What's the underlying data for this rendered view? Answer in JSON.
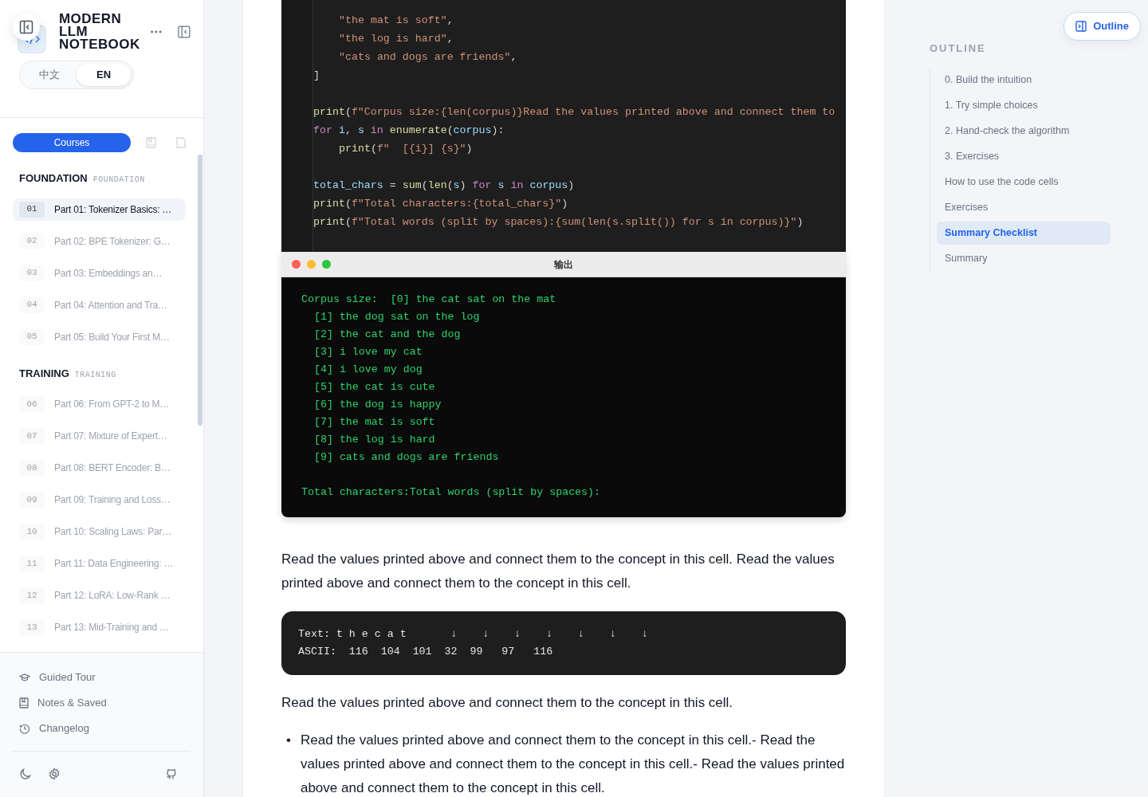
{
  "sidebar": {
    "title": [
      "MODERN",
      "LLM",
      "NOTEBOOK"
    ],
    "languages": [
      {
        "label": "中文",
        "selected": false
      },
      {
        "label": "EN",
        "selected": true
      }
    ],
    "tabs": [
      {
        "kind": "label",
        "label": "Courses",
        "selected": true
      },
      {
        "kind": "notebook",
        "selected": false
      },
      {
        "kind": "page",
        "selected": false
      }
    ],
    "sections": [
      {
        "title": "FOUNDATION",
        "subtitle": "FOUNDATION",
        "items": [
          {
            "number": "01",
            "title": "Part 01: Tokenizer Basics: …",
            "selected": true
          },
          {
            "number": "02",
            "title": "Part 02: BPE Tokenizer: G…",
            "selected": false
          },
          {
            "number": "03",
            "title": "Part 03: Embeddings an…",
            "selected": false
          },
          {
            "number": "04",
            "title": "Part 04: Attention and Tra…",
            "selected": false
          },
          {
            "number": "05",
            "title": "Part 05: Build Your First M…",
            "selected": false
          }
        ]
      },
      {
        "title": "TRAINING",
        "subtitle": "TRAINING",
        "items": [
          {
            "number": "06",
            "title": "Part 06: From GPT-2 to M…",
            "selected": false
          },
          {
            "number": "07",
            "title": "Part 07: Mixture of Expert…",
            "selected": false
          },
          {
            "number": "08",
            "title": "Part 08: BERT Encoder: B…",
            "selected": false
          },
          {
            "number": "09",
            "title": "Part 09: Training and Loss…",
            "selected": false
          },
          {
            "number": "10",
            "title": "Part 10: Scaling Laws: Par…",
            "selected": false
          },
          {
            "number": "11",
            "title": "Part 11: Data Engineering: …",
            "selected": false
          },
          {
            "number": "12",
            "title": "Part 12: LoRA: Low-Rank …",
            "selected": false
          },
          {
            "number": "13",
            "title": "Part 13: Mid-Training and …",
            "selected": false
          }
        ]
      }
    ],
    "footer_links": [
      {
        "kind": "tour",
        "label": "Guided Tour"
      },
      {
        "kind": "notes",
        "label": "Notes & Saved"
      },
      {
        "kind": "history",
        "label": "Changelog"
      }
    ]
  },
  "code_cell": {
    "blocks": [
      [
        {
          "indent": true,
          "tokens": [
            {
              "kind": "str",
              "text": "\"the mat is soft\""
            },
            {
              "kind": "plain",
              "text": ","
            }
          ]
        },
        {
          "indent": true,
          "tokens": [
            {
              "kind": "str",
              "text": "\"the log is hard\""
            },
            {
              "kind": "plain",
              "text": ","
            }
          ]
        },
        {
          "indent": true,
          "tokens": [
            {
              "kind": "str",
              "text": "\"cats and dogs are friends\""
            },
            {
              "kind": "plain",
              "text": ","
            }
          ]
        },
        {
          "indent": false,
          "tokens": [
            {
              "kind": "plain",
              "text": "]"
            }
          ]
        }
      ],
      [
        {
          "indent": false,
          "tokens": [
            {
              "kind": "fn",
              "text": "print"
            },
            {
              "kind": "plain",
              "text": "("
            },
            {
              "kind": "str",
              "text": "f\"Corpus size:{len(corpus)}Read the values printed above and connect them to"
            }
          ]
        },
        {
          "indent": false,
          "tokens": [
            {
              "kind": "kw",
              "text": "for"
            },
            {
              "kind": "var",
              "text": " i"
            },
            {
              "kind": "plain",
              "text": ", "
            },
            {
              "kind": "var",
              "text": "s"
            },
            {
              "kind": "kw",
              "text": " in"
            },
            {
              "kind": "fn",
              "text": " enumerate"
            },
            {
              "kind": "plain",
              "text": "("
            },
            {
              "kind": "var",
              "text": "corpus"
            },
            {
              "kind": "plain",
              "text": "):"
            }
          ]
        },
        {
          "indent": true,
          "tokens": [
            {
              "kind": "fn",
              "text": "print"
            },
            {
              "kind": "plain",
              "text": "("
            },
            {
              "kind": "str",
              "text": "f\"  [{i}] {s}\""
            },
            {
              "kind": "plain",
              "text": ")"
            }
          ]
        }
      ],
      [
        {
          "indent": false,
          "tokens": [
            {
              "kind": "var",
              "text": "total_chars"
            },
            {
              "kind": "plain",
              "text": " = "
            },
            {
              "kind": "fn",
              "text": "sum"
            },
            {
              "kind": "plain",
              "text": "("
            },
            {
              "kind": "fn",
              "text": "len"
            },
            {
              "kind": "plain",
              "text": "("
            },
            {
              "kind": "var",
              "text": "s"
            },
            {
              "kind": "plain",
              "text": ") "
            },
            {
              "kind": "kw",
              "text": "for"
            },
            {
              "kind": "var",
              "text": " s"
            },
            {
              "kind": "kw",
              "text": " in"
            },
            {
              "kind": "var",
              "text": " corpus"
            },
            {
              "kind": "plain",
              "text": ")"
            }
          ]
        },
        {
          "indent": false,
          "tokens": [
            {
              "kind": "fn",
              "text": "print"
            },
            {
              "kind": "plain",
              "text": "("
            },
            {
              "kind": "str",
              "text": "f\"Total characters:{total_chars}\""
            },
            {
              "kind": "plain",
              "text": ")"
            }
          ]
        },
        {
          "indent": false,
          "tokens": [
            {
              "kind": "fn",
              "text": "print"
            },
            {
              "kind": "plain",
              "text": "("
            },
            {
              "kind": "str",
              "text": "f\"Total words (split by spaces):{sum(len(s.split()) for s in corpus)}\""
            },
            {
              "kind": "plain",
              "text": ")"
            }
          ]
        }
      ]
    ]
  },
  "output": {
    "title": "输出",
    "lines": [
      "Corpus size:  [0] the cat sat on the mat",
      "  [1] the dog sat on the log",
      "  [2] the cat and the dog",
      "  [3] i love my cat",
      "  [4] i love my dog",
      "  [5] the cat is cute",
      "  [6] the dog is happy",
      "  [7] the mat is soft",
      "  [8] the log is hard",
      "  [9] cats and dogs are friends"
    ],
    "totals": "Total characters:Total words (split by spaces):"
  },
  "paragraph_1": "Read the values printed above and connect them to the concept in this cell. Read the values printed above and connect them to the concept in this cell.",
  "ascii_block": [
    "Text: t h e c a t       ↓    ↓    ↓    ↓    ↓    ↓    ↓",
    "ASCII:  116  104  101  32  99   97   116"
  ],
  "paragraph_2": "Read the values printed above and connect them to the concept in this cell.",
  "bullets": [
    {
      "marker": "•",
      "text": "Read the values printed above and connect them to the concept in this cell.- Read the values printed above and connect them to the concept in this cell.- Read the values printed above and connect them to the concept in this cell."
    }
  ],
  "outline": {
    "button": "Outline",
    "heading": "OUTLINE",
    "items": [
      {
        "label": "0. Build the intuition",
        "selected": false
      },
      {
        "label": "1. Try simple choices",
        "selected": false
      },
      {
        "label": "2. Hand-check the algorithm",
        "selected": false
      },
      {
        "label": "3. Exercises",
        "selected": false
      },
      {
        "label": "How to use the code cells",
        "selected": false
      },
      {
        "label": "Exercises",
        "selected": false
      },
      {
        "label": "Summary Checklist",
        "selected": true
      },
      {
        "label": "Summary",
        "selected": false
      }
    ]
  }
}
